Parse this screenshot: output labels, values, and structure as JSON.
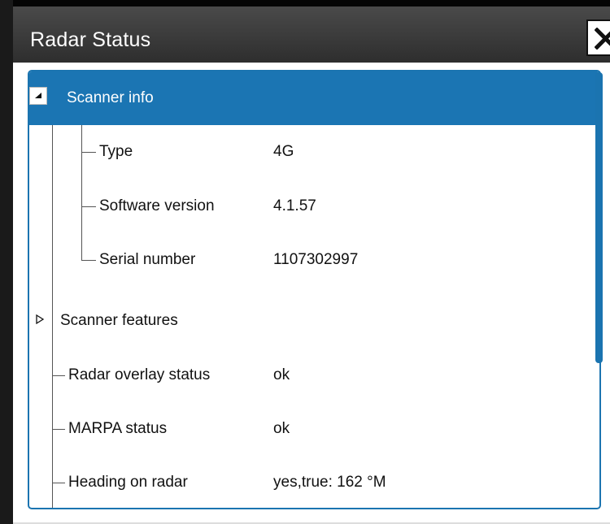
{
  "dialog": {
    "title": "Radar Status",
    "close_icon": "close-icon"
  },
  "tree": {
    "scanner_info": {
      "label": "Scanner info",
      "expanded": true,
      "children": [
        {
          "label": "Type",
          "value": "4G"
        },
        {
          "label": "Software version",
          "value": "4.1.57"
        },
        {
          "label": "Serial number",
          "value": "1107302997"
        }
      ]
    },
    "scanner_features": {
      "label": "Scanner features",
      "expanded": false
    },
    "items": [
      {
        "label": "Radar overlay status",
        "value": "ok"
      },
      {
        "label": "MARPA status",
        "value": "ok"
      },
      {
        "label": "Heading on radar",
        "value": "yes,true: 162 °M"
      }
    ]
  },
  "colors": {
    "accent": "#1b75b3",
    "titlebar": "#3a3a3a",
    "background": "#ffffff"
  }
}
